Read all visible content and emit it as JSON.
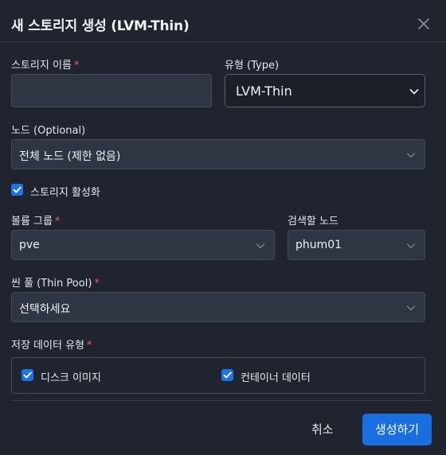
{
  "dialog": {
    "title": "새 스토리지 생성 (LVM-Thin)",
    "close_glyph": "✕"
  },
  "fields": {
    "storage_name": {
      "label": "스토리지 이름",
      "required": "*",
      "value": "",
      "placeholder": ""
    },
    "type": {
      "label": "유형 (Type)",
      "selected": "LVM-Thin"
    },
    "nodes": {
      "label": "노드 (Optional)",
      "selected": "전체 노드 (제한 없음)"
    },
    "enable_storage": {
      "label": "스토리지 활성화",
      "checked": true
    },
    "volume_group": {
      "label": "볼륨 그룹",
      "required": "*",
      "selected": "pve"
    },
    "scan_node": {
      "label": "검색할 노드",
      "selected": "phum01"
    },
    "thin_pool": {
      "label": "씬 풀 (Thin Pool)",
      "required": "*",
      "selected": "선택하세요"
    },
    "content_types": {
      "label": "저장 데이터 유형",
      "required": "*",
      "options": [
        {
          "label": "디스크 이미지",
          "checked": true
        },
        {
          "label": "컨테이너 데이터",
          "checked": true
        }
      ]
    }
  },
  "footer": {
    "cancel_label": "취소",
    "submit_label": "생성하기"
  },
  "colors": {
    "accent": "#1a6fe0",
    "required": "#ef5b5b",
    "background": "#1f242e"
  }
}
